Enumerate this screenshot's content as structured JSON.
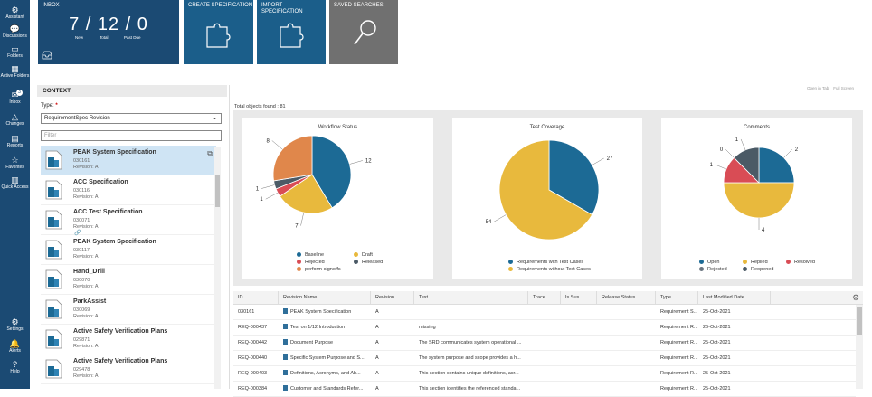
{
  "nav": [
    {
      "icon": "⚙",
      "label": "Assistant"
    },
    {
      "icon": "💬",
      "label": "Discussions"
    },
    {
      "icon": "▭",
      "label": "Folders"
    },
    {
      "icon": "▦",
      "label": "Active Folders"
    },
    {
      "icon": "✉",
      "label": "Inbox",
      "badge": "3"
    },
    {
      "icon": "△",
      "label": "Changes"
    },
    {
      "icon": "▤",
      "label": "Reports"
    },
    {
      "icon": "☆",
      "label": "Favorites"
    },
    {
      "icon": "▥",
      "label": "Quick Access"
    }
  ],
  "nav_bottom": [
    {
      "icon": "⚙",
      "label": "Settings"
    },
    {
      "icon": "🔔",
      "label": "Alerts"
    },
    {
      "icon": "?",
      "label": "Help"
    }
  ],
  "tiles": {
    "inbox": {
      "title": "INBOX",
      "new": "7",
      "total": "12",
      "past_due": "0",
      "new_label": "New",
      "total_label": "Total",
      "past_due_label": "Past Due"
    },
    "create": {
      "title": "CREATE SPECIFICATION"
    },
    "import": {
      "title": "IMPORT SPECIFICATION"
    },
    "saved": {
      "title": "SAVED SEARCHES"
    }
  },
  "context": {
    "header": "CONTEXT",
    "type_label": "Type:",
    "type_required": "*",
    "type_value": "RequirementSpec Revision",
    "filter_placeholder": "Filter",
    "items": [
      {
        "name": "PEAK System Specification",
        "id": "030161",
        "revision": "Revision:  A"
      },
      {
        "name": "ACC Specification",
        "id": "030116",
        "revision": "Revision:  A"
      },
      {
        "name": "ACC Test Specification",
        "id": "030071",
        "revision": "Revision:  A"
      },
      {
        "name": "PEAK System Specification",
        "id": "030117",
        "revision": "Revision:  A"
      },
      {
        "name": "Hand_Drill",
        "id": "030070",
        "revision": "Revision:  A"
      },
      {
        "name": "ParkAssist",
        "id": "030069",
        "revision": "Revision:  A"
      },
      {
        "name": "Active Safety Verification Plans",
        "id": "029871",
        "revision": "Revision:  A"
      },
      {
        "name": "Active Safety Verification Plans",
        "id": "029478",
        "revision": "Revision:  A"
      }
    ]
  },
  "results": {
    "total_label": "Total objects found : 81",
    "zoom_open": "Open in Tab",
    "zoom_full": "Full Screen"
  },
  "colors": {
    "blue": "#1c6a95",
    "yellow": "#e8b93d",
    "red": "#d94c55",
    "orange": "#e0874b",
    "dark": "#4b5a66"
  },
  "charts": [
    {
      "title": "Workflow Status",
      "slices": [
        {
          "label": "Baseline",
          "value": 12,
          "color": "#1c6a95"
        },
        {
          "label": "Draft",
          "value": 7,
          "color": "#e8b93d"
        },
        {
          "label": "Rejected",
          "value": 1,
          "color": "#d94c55"
        },
        {
          "label": "Released",
          "value": 1,
          "color": "#4b5a66"
        },
        {
          "label": "perform-signoffs",
          "value": 8,
          "color": "#e0874b"
        }
      ]
    },
    {
      "title": "Test Coverage",
      "slices": [
        {
          "label": "Requirements with Test Cases",
          "value": 27,
          "color": "#1c6a95"
        },
        {
          "label": "Requirements without Test Cases",
          "value": 54,
          "color": "#e8b93d"
        }
      ]
    },
    {
      "title": "Comments",
      "slices": [
        {
          "label": "Open",
          "value": 2,
          "color": "#1c6a95"
        },
        {
          "label": "Replied",
          "value": 4,
          "color": "#e8b93d"
        },
        {
          "label": "Resolved",
          "value": 1,
          "color": "#d94c55"
        },
        {
          "label": "Rejected",
          "value": 0,
          "color": "#6a7580"
        },
        {
          "label": "Reopened",
          "value": 1,
          "color": "#4b5a66"
        }
      ]
    }
  ],
  "grid": {
    "columns": [
      "ID",
      "Revision Name",
      "Revision",
      "Text",
      "Trace ...",
      "Is Sus...",
      "Release Status",
      "Type",
      "Last Modified Date"
    ],
    "rows": [
      [
        "030161",
        "PEAK System Specification",
        "A",
        "",
        "",
        "",
        "",
        "Requirement S...",
        "25-Oct-2021"
      ],
      [
        "REQ-000437",
        "Test on 1/12 Introduction",
        "A",
        "missing",
        "",
        "",
        "",
        "Requirement R...",
        "26-Oct-2021"
      ],
      [
        "REQ-000442",
        "Document Purpose",
        "A",
        "The SRD communicates system operational ...",
        "",
        "",
        "",
        "Requirement R...",
        "25-Oct-2021"
      ],
      [
        "REQ-000440",
        "Specific System Purpose and S...",
        "A",
        "The system purpose and scope provides a h...",
        "",
        "",
        "",
        "Requirement R...",
        "25-Oct-2021"
      ],
      [
        "REQ-000403",
        "Definitions, Acronyms, and Ab...",
        "A",
        "This section contains unique definitions, acr...",
        "",
        "",
        "",
        "Requirement R...",
        "25-Oct-2021"
      ],
      [
        "REQ-000384",
        "Customer and Standards Refer...",
        "A",
        "This section identifies the referenced standa...",
        "",
        "",
        "",
        "Requirement R...",
        "25-Oct-2021"
      ]
    ]
  },
  "chart_data": [
    {
      "type": "pie",
      "title": "Workflow Status",
      "categories": [
        "Baseline",
        "Draft",
        "Rejected",
        "Released",
        "perform-signoffs"
      ],
      "values": [
        12,
        7,
        1,
        1,
        8
      ],
      "legend": "bottom"
    },
    {
      "type": "pie",
      "title": "Test Coverage",
      "categories": [
        "Requirements with Test Cases",
        "Requirements without Test Cases"
      ],
      "values": [
        27,
        54
      ],
      "legend": "bottom"
    },
    {
      "type": "pie",
      "title": "Comments",
      "categories": [
        "Open",
        "Replied",
        "Resolved",
        "Rejected",
        "Reopened"
      ],
      "values": [
        2,
        4,
        1,
        0,
        1
      ],
      "legend": "bottom"
    }
  ]
}
